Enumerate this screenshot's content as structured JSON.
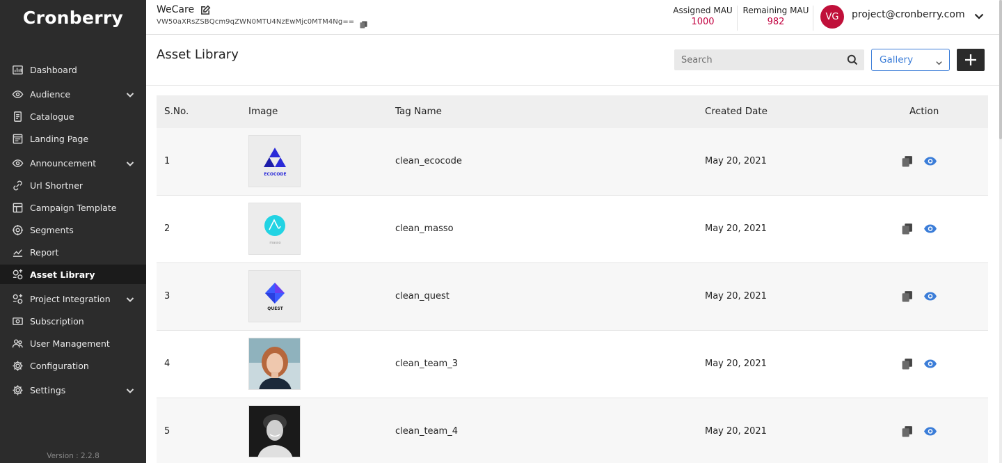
{
  "app": {
    "logo": "Cronberry",
    "version": "Version : 2.2.8"
  },
  "sidebar": {
    "items": [
      {
        "label": "Dashboard",
        "icon": "dashboard-icon",
        "expandable": false
      },
      {
        "label": "Audience",
        "icon": "eye-icon",
        "expandable": true
      },
      {
        "label": "Catalogue",
        "icon": "catalogue-icon",
        "expandable": false
      },
      {
        "label": "Landing Page",
        "icon": "landing-page-icon",
        "expandable": false
      },
      {
        "label": "Announcement",
        "icon": "eye-icon",
        "expandable": true
      },
      {
        "label": "Url Shortner",
        "icon": "link-icon",
        "expandable": false
      },
      {
        "label": "Campaign Template",
        "icon": "template-icon",
        "expandable": false
      },
      {
        "label": "Segments",
        "icon": "segments-icon",
        "expandable": false
      },
      {
        "label": "Report",
        "icon": "report-icon",
        "expandable": false
      },
      {
        "label": "Asset Library",
        "icon": "asset-library-icon",
        "expandable": false,
        "active": true
      },
      {
        "label": "Project Integration",
        "icon": "integration-icon",
        "expandable": true
      },
      {
        "label": "Subscription",
        "icon": "subscription-icon",
        "expandable": false
      },
      {
        "label": "User Management",
        "icon": "users-icon",
        "expandable": false
      },
      {
        "label": "Configuration",
        "icon": "gear-icon",
        "expandable": false
      },
      {
        "label": "Settings",
        "icon": "gear-icon",
        "expandable": true
      }
    ]
  },
  "header": {
    "project_name": "WeCare",
    "project_key": "VW50aXRsZSBQcm9qZWN0MTU4NzEwMjc0MTM4Ng==",
    "assigned_mau_label": "Assigned MAU",
    "assigned_mau_value": "1000",
    "remaining_mau_label": "Remaining MAU",
    "remaining_mau_value": "982",
    "avatar_initials": "VG",
    "user_email": "project@cronberry.com"
  },
  "page": {
    "title": "Asset Library",
    "search_placeholder": "Search",
    "view_mode": "Gallery"
  },
  "table": {
    "columns": [
      "S.No.",
      "Image",
      "Tag Name",
      "Created Date",
      "Action"
    ],
    "rows": [
      {
        "sno": "1",
        "image": "ecocode-logo",
        "image_text": "ECOCODE",
        "tag": "clean_ecocode",
        "date": "May 20, 2021"
      },
      {
        "sno": "2",
        "image": "masso-logo",
        "image_text": "masso",
        "tag": "clean_masso",
        "date": "May 20, 2021"
      },
      {
        "sno": "3",
        "image": "quest-logo",
        "image_text": "QUEST",
        "tag": "clean_quest",
        "date": "May 20, 2021"
      },
      {
        "sno": "4",
        "image": "team-photo-woman",
        "tag": "clean_team_3",
        "date": "May 20, 2021"
      },
      {
        "sno": "5",
        "image": "team-photo-man",
        "tag": "clean_team_4",
        "date": "May 20, 2021"
      }
    ]
  },
  "colors": {
    "sidebar_bg": "#2c2c2c",
    "accent_blue": "#3b7dd8",
    "mau_value": "#c2003f",
    "avatar_bg": "#c0103a"
  }
}
